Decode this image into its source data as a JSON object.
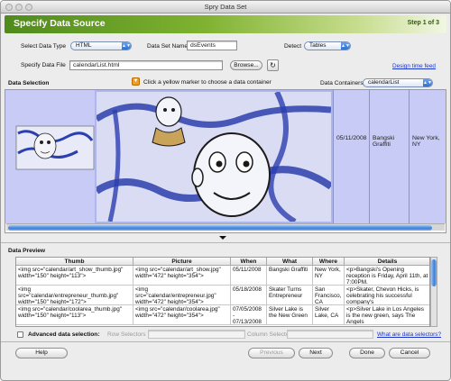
{
  "window": {
    "title": "Spry Data Set"
  },
  "banner": {
    "title": "Specify Data Source",
    "step": "Step 1 of 3"
  },
  "form": {
    "data_type_label": "Select Data Type",
    "data_type_value": "HTML",
    "data_set_name_label": "Data Set Name",
    "data_set_name_value": "dsEvents",
    "detect_label": "Detect",
    "detect_value": "Tables",
    "data_file_label": "Specify Data File",
    "data_file_value": "calendarList.html",
    "browse_label": "Browse...",
    "design_time_feed_label": "Design time feed"
  },
  "selection": {
    "label": "Data Selection",
    "hint": "Click a yellow marker to choose a data container",
    "containers_label": "Data Containers",
    "containers_value": "calendarList",
    "row_cells": [
      "05/11/2008",
      "Bangski Graffiti",
      "New York, NY"
    ]
  },
  "preview": {
    "label": "Data Preview",
    "columns": [
      "Thumb",
      "Picture",
      "When",
      "What",
      "Where",
      "Details"
    ],
    "rows": [
      [
        "<img src=\"calendar/art_show_thumb.jpg\" width=\"150\" height=\"113\">",
        "<img src=\"calendar/art_show.jpg\" width=\"472\" height=\"354\">",
        "05/11/2008",
        "Bangski Graffiti",
        "New York, NY",
        "<p>Bangski's Opening reception is Friday, April 11th, at 7:00PM."
      ],
      [
        "<img src=\"calendar/entrepreneur_thumb.jpg\" width=\"150\" height=\"172\">",
        "<img src=\"calendar/entrepreneur.jpg\" width=\"472\" height=\"354\">",
        "05/18/2008",
        "Skater Turns Entrepreneur",
        "San Francisco, CA",
        "<p>Skater, Chevon Hicks, is celebrating his successful company's"
      ],
      [
        "<img src=\"calendar/coolarea_thumb.jpg\" width=\"150\" height=\"113\">",
        "<img src=\"calendar/coolarea.jpg\" width=\"472\" height=\"354\">",
        "07/05/2008 - 07/13/2008",
        "Silver Lake is the New Green",
        "Silver Lake, CA",
        "<p>Silver Lake in Los Angeles is the new green, says The Angels"
      ]
    ]
  },
  "advanced": {
    "label": "Advanced data selection:",
    "row_selectors": "Row Selectors",
    "column_selectors": "Column Selectors",
    "help_link": "What are data selectors?"
  },
  "buttons": {
    "help": "Help",
    "previous": "Previous",
    "next": "Next",
    "done": "Done",
    "cancel": "Cancel"
  },
  "colors": {
    "banner": "#7fb230",
    "selection_fill": "#c7cbf6",
    "scroll_blue": "#3f7fd8"
  }
}
